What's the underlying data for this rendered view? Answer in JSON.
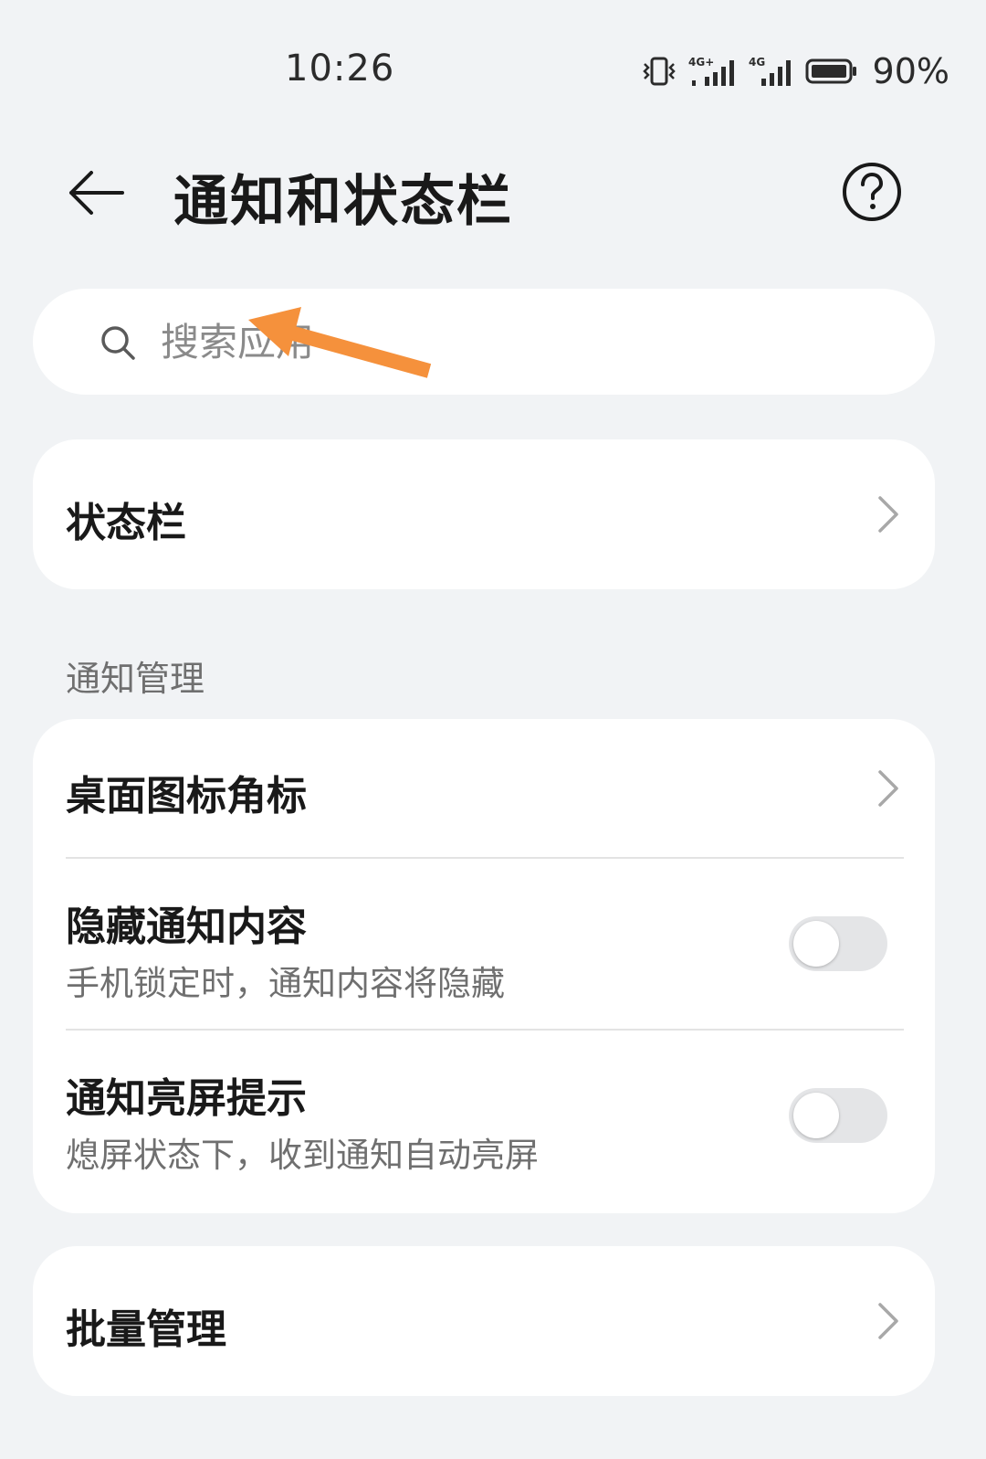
{
  "status_bar": {
    "time": "10:26",
    "network1": "4G+",
    "network2": "4G",
    "battery": "90%"
  },
  "header": {
    "title": "通知和状态栏"
  },
  "search": {
    "placeholder": "搜索应用"
  },
  "status_bar_card": {
    "label": "状态栏"
  },
  "notification_section": {
    "header": "通知管理",
    "items": [
      {
        "label": "桌面图标角标"
      },
      {
        "label": "隐藏通知内容",
        "sublabel": "手机锁定时，通知内容将隐藏",
        "enabled": false
      },
      {
        "label": "通知亮屏提示",
        "sublabel": "熄屏状态下，收到通知自动亮屏",
        "enabled": false
      }
    ]
  },
  "batch_card": {
    "label": "批量管理"
  },
  "colors": {
    "background": "#f1f3f5",
    "card": "#ffffff",
    "annotation": "#f5913c",
    "toggle_off": "#e4e5e7"
  }
}
